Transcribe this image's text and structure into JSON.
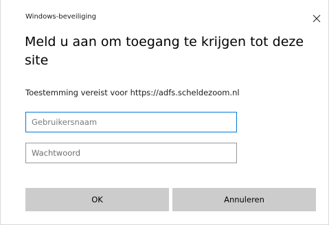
{
  "window": {
    "title": "Windows-beveiliging",
    "close_icon": "close-icon"
  },
  "dialog": {
    "heading": "Meld u aan om toegang te krijgen tot deze site",
    "permission_text": "Toestemming vereist voor https://adfs.scheldezoom.nl"
  },
  "form": {
    "username": {
      "value": "",
      "placeholder": "Gebruikersnaam"
    },
    "password": {
      "value": "",
      "placeholder": "Wachtwoord"
    }
  },
  "buttons": {
    "ok_label": "OK",
    "cancel_label": "Annuleren"
  },
  "colors": {
    "focus_border": "#0078d7",
    "button_bg": "#cccccc"
  }
}
